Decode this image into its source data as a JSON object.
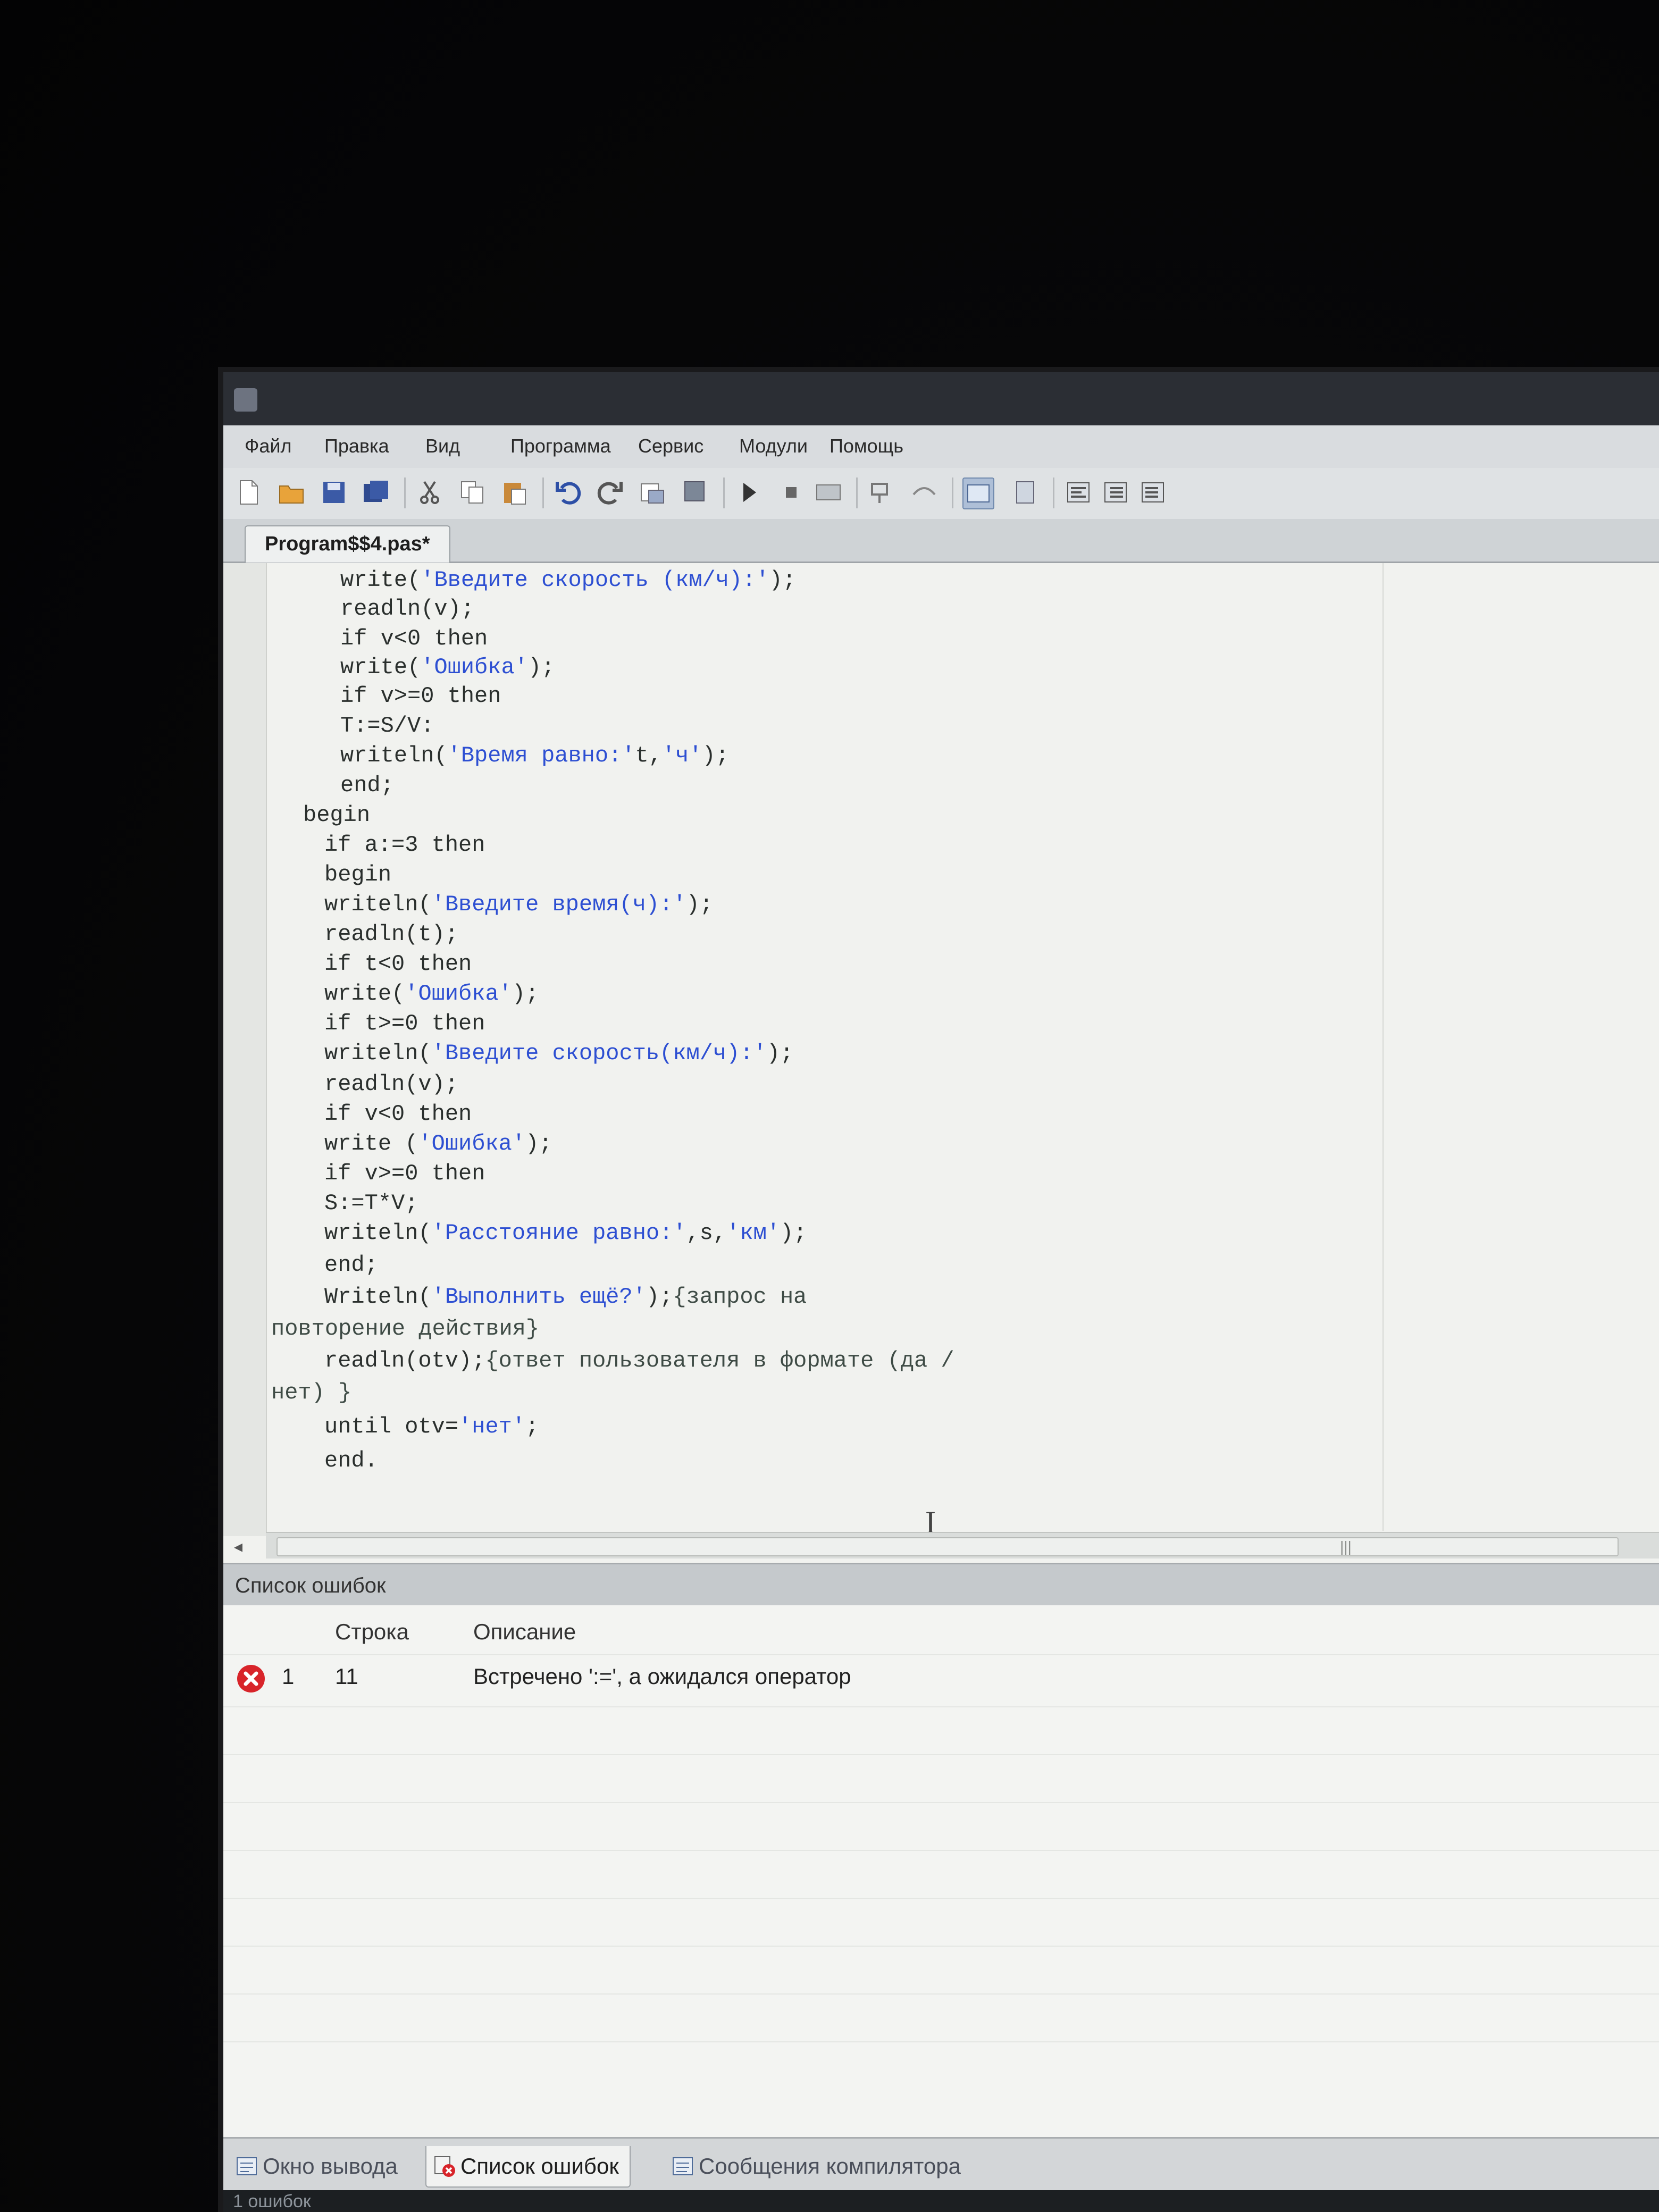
{
  "menu": [
    "Файл",
    "Правка",
    "Вид",
    "Программа",
    "Сервис",
    "Модули",
    "Помощь"
  ],
  "file_tab": "Program$$4.pas*",
  "code_lines": [
    [
      {
        "t": "write(",
        "k": "p"
      },
      {
        "t": "'Введите скорость (км/ч):'",
        "k": "s"
      },
      {
        "t": ");",
        "k": "p"
      }
    ],
    [
      {
        "t": "readln(v);",
        "k": "p"
      }
    ],
    [
      {
        "t": "if v<0 then",
        "k": "p"
      }
    ],
    [
      {
        "t": "write(",
        "k": "p"
      },
      {
        "t": "'Ошибка'",
        "k": "s"
      },
      {
        "t": ");",
        "k": "p"
      }
    ],
    [
      {
        "t": "if v>=0 then",
        "k": "p"
      }
    ],
    [
      {
        "t": "T:=S/V:",
        "k": "p"
      }
    ],
    [
      {
        "t": "writeln(",
        "k": "p"
      },
      {
        "t": "'Время равно:'",
        "k": "s"
      },
      {
        "t": "t,",
        "k": "p"
      },
      {
        "t": "'ч'",
        "k": "s"
      },
      {
        "t": ");",
        "k": "p"
      }
    ],
    [
      {
        "t": "end;",
        "k": "p"
      }
    ],
    [
      {
        "t": "begin",
        "k": "p"
      }
    ],
    [
      {
        "t": "if a:=3 then",
        "k": "p"
      }
    ],
    [
      {
        "t": "begin",
        "k": "p"
      }
    ],
    [
      {
        "t": "writeln(",
        "k": "p"
      },
      {
        "t": "'Введите время(ч):'",
        "k": "s"
      },
      {
        "t": ");",
        "k": "p"
      }
    ],
    [
      {
        "t": "readln(t);",
        "k": "p"
      }
    ],
    [
      {
        "t": "if t<0 then",
        "k": "p"
      }
    ],
    [
      {
        "t": "write(",
        "k": "p"
      },
      {
        "t": "'Ошибка'",
        "k": "s"
      },
      {
        "t": ");",
        "k": "p"
      }
    ],
    [
      {
        "t": "if t>=0 then",
        "k": "p"
      }
    ],
    [
      {
        "t": "writeln(",
        "k": "p"
      },
      {
        "t": "'Введите скорость(км/ч):'",
        "k": "s"
      },
      {
        "t": ");",
        "k": "p"
      }
    ],
    [
      {
        "t": "readln(v);",
        "k": "p"
      }
    ],
    [
      {
        "t": "if v<0 then",
        "k": "p"
      }
    ],
    [
      {
        "t": "write (",
        "k": "p"
      },
      {
        "t": "'Ошибка'",
        "k": "s"
      },
      {
        "t": ");",
        "k": "p"
      }
    ],
    [
      {
        "t": "if v>=0 then",
        "k": "p"
      }
    ],
    [
      {
        "t": "S:=T*V;",
        "k": "p"
      }
    ],
    [
      {
        "t": "writeln(",
        "k": "p"
      },
      {
        "t": "'Расстояние равно:'",
        "k": "s"
      },
      {
        "t": ",s,",
        "k": "p"
      },
      {
        "t": "'км'",
        "k": "s"
      },
      {
        "t": ");",
        "k": "p"
      }
    ],
    [
      {
        "t": "end;",
        "k": "p"
      }
    ],
    [
      {
        "t": "Writeln(",
        "k": "p"
      },
      {
        "t": "'Выполнить ещё?'",
        "k": "s"
      },
      {
        "t": ");",
        "k": "p"
      },
      {
        "t": "{запрос на",
        "k": "c"
      }
    ],
    [
      {
        "t": "повторение действия}",
        "k": "c"
      }
    ],
    [
      {
        "t": "readln(otv);",
        "k": "p"
      },
      {
        "t": "{ответ пользователя в формате (да /",
        "k": "c"
      }
    ],
    [
      {
        "t": "нет) }",
        "k": "c"
      }
    ],
    [
      {
        "t": "until otv=",
        "k": "p"
      },
      {
        "t": "'нет'",
        "k": "s"
      },
      {
        "t": ";",
        "k": "p"
      }
    ],
    [
      {
        "t": "end.",
        "k": "p"
      }
    ]
  ],
  "error_panel": {
    "title": "Список ошибок",
    "col_line": "Строка",
    "col_desc": "Описание",
    "rows": [
      {
        "num": "1",
        "line": "11",
        "desc": "Встречено ':=', а ожидался оператор"
      }
    ]
  },
  "bottom_tabs": [
    "Окно вывода",
    "Список ошибок",
    "Сообщения компилятора"
  ],
  "status_text": "1 ошибок"
}
